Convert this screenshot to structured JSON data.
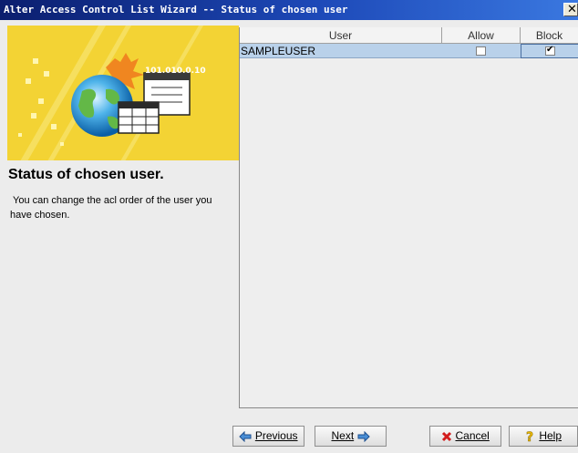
{
  "window": {
    "title": "Alter Access Control List Wizard -- Status of chosen user"
  },
  "banner": {
    "ip_text": "101.010.0.10"
  },
  "panel": {
    "heading": "Status of chosen user.",
    "description": "You can change the acl order of the user you have chosen."
  },
  "table": {
    "columns": [
      "User",
      "Allow",
      "Block"
    ],
    "rows": [
      {
        "user": "SAMPLEUSER",
        "allow": false,
        "block": true
      }
    ]
  },
  "buttons": {
    "previous": "Previous",
    "next": "Next",
    "cancel": "Cancel",
    "help": "Help"
  },
  "colors": {
    "titlebar_start": "#0b1e6e",
    "banner_yellow": "#f3d334",
    "row_selected": "#b9d1ea"
  },
  "icons": [
    "close-icon",
    "globe-icon",
    "window-icon",
    "table-icon",
    "arrow-left-icon",
    "arrow-right-icon",
    "cancel-x-icon",
    "help-question-icon"
  ]
}
